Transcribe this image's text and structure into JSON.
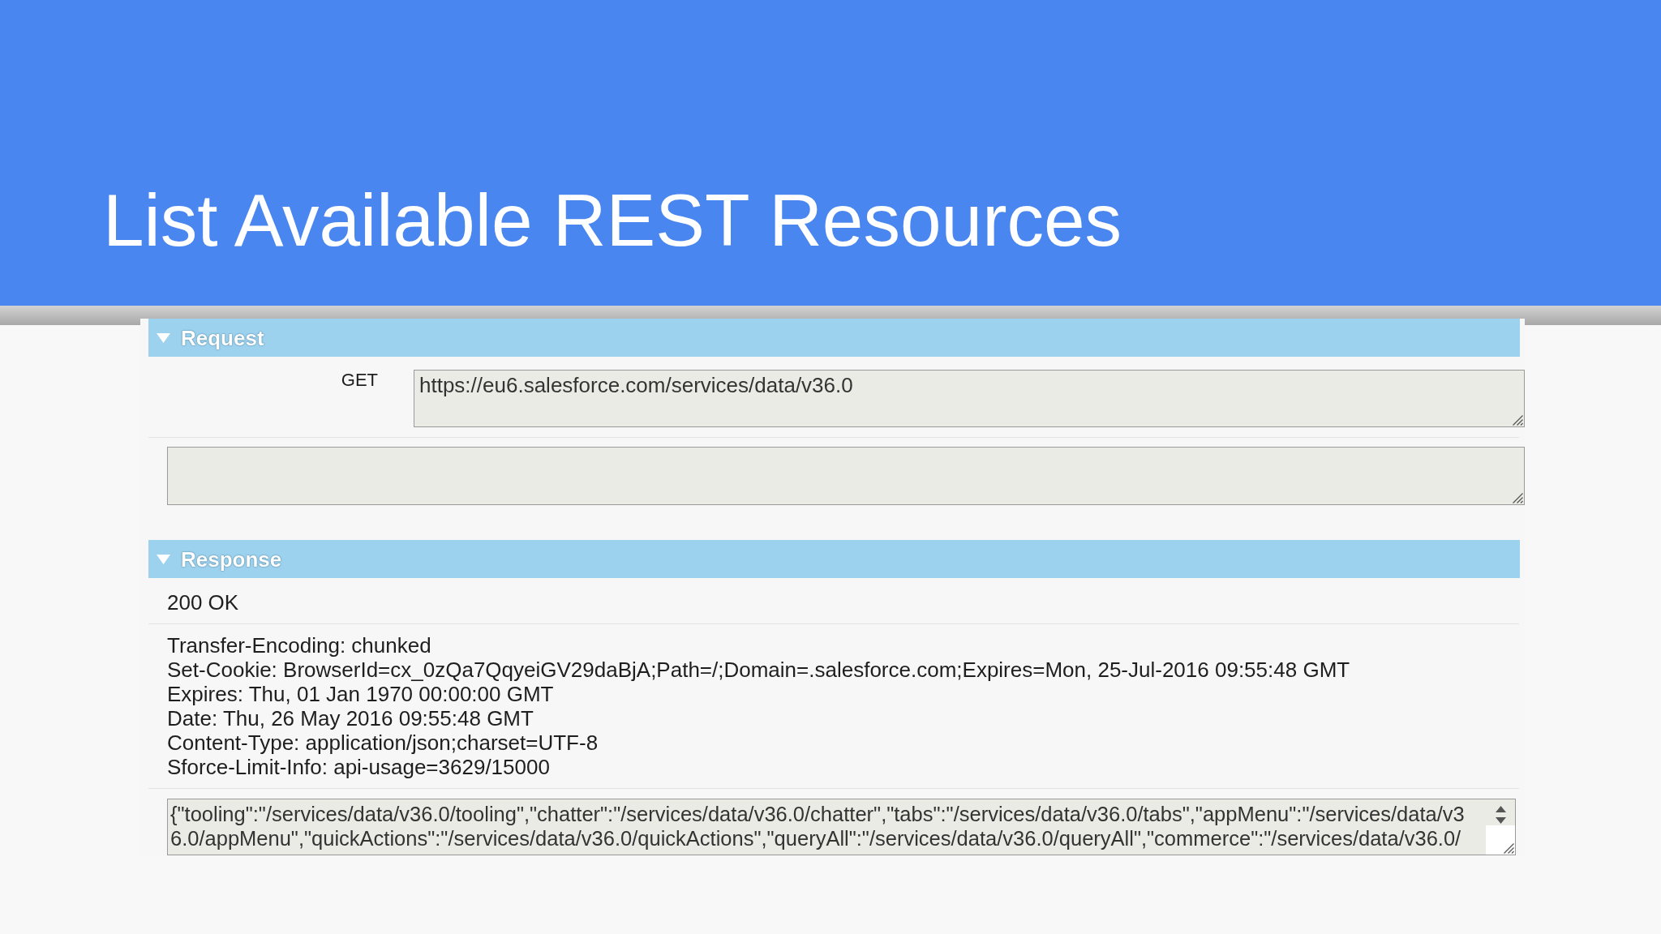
{
  "slide": {
    "title": "List Available REST Resources"
  },
  "sections": [
    {
      "kind": "request",
      "title": "Request",
      "expanded": true,
      "method": "GET",
      "url": "https://eu6.salesforce.com/services/data/v36.0"
    },
    {
      "kind": "response",
      "title": "Response",
      "expanded": true,
      "status": "200 OK",
      "headers": [
        "Transfer-Encoding: chunked",
        "Set-Cookie: BrowserId=cx_0zQa7QqyeiGV29daBjA;Path=/;Domain=.salesforce.com;Expires=Mon, 25-Jul-2016 09:55:48 GMT",
        "Expires: Thu, 01 Jan 1970 00:00:00 GMT",
        "Date: Thu, 26 May 2016 09:55:48 GMT",
        "Content-Type: application/json;charset=UTF-8",
        "Sforce-Limit-Info: api-usage=3629/15000"
      ],
      "body_lines": [
        "{\"tooling\":\"/services/data/v36.0/tooling\",\"chatter\":\"/services/data/v36.0/chatter\",\"tabs\":\"/services/data/v36.0/tabs\",\"appMenu\":\"/services/data/v3",
        "6.0/appMenu\",\"quickActions\":\"/services/data/v36.0/quickActions\",\"queryAll\":\"/services/data/v36.0/queryAll\",\"commerce\":\"/services/data/v36.0/"
      ]
    }
  ]
}
